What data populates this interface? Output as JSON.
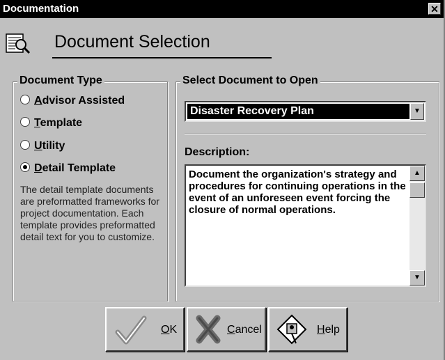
{
  "window": {
    "title": "Documentation",
    "close_glyph": "✕"
  },
  "header": {
    "title": "Document Selection",
    "icon": "document-search-icon"
  },
  "document_type": {
    "legend": "Document Type",
    "options": [
      {
        "label": "Advisor Assisted",
        "mnemonic": "A",
        "rest": "dvisor Assisted",
        "selected": false
      },
      {
        "label": "Template",
        "mnemonic": "T",
        "rest": "emplate",
        "selected": false
      },
      {
        "label": "Utility",
        "mnemonic": "U",
        "rest": "tility",
        "selected": false
      },
      {
        "label": "Detail Template",
        "mnemonic": "D",
        "rest": "etail Template",
        "selected": true
      }
    ],
    "description": "The detail template documents are preformatted frameworks for project documentation. Each template provides preformatted detail text for you to customize."
  },
  "select_document": {
    "legend": "Select Document to Open",
    "selected_value": "Disaster Recovery Plan",
    "description_label": "Description:",
    "description_text": "Document the organization's strategy and procedures for continuing operations in the event of an unforeseen event forcing the closure of normal operations."
  },
  "buttons": {
    "ok": {
      "label": "OK",
      "mnemonic": "O",
      "rest": "K",
      "icon": "checkmark-icon"
    },
    "cancel": {
      "label": "Cancel",
      "mnemonic": "C",
      "rest": "ancel",
      "icon": "cancel-x-icon"
    },
    "help": {
      "label": "Help",
      "mnemonic": "H",
      "rest": "elp",
      "icon": "help-diamond-icon"
    }
  }
}
